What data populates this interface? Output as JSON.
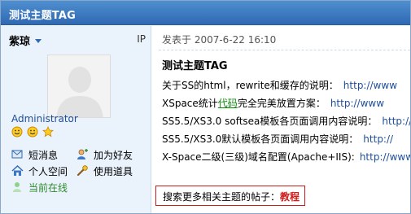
{
  "window": {
    "title": "测试主题TAG"
  },
  "sidebar": {
    "username": "紫琼",
    "ip_label": "IP",
    "role": "Administrator",
    "badges": [
      "smiley-icon",
      "smiley-icon",
      "star-icon"
    ],
    "actions": [
      {
        "label": "短消息",
        "icon": "message-icon"
      },
      {
        "label": "加为好友",
        "icon": "add-friend-icon"
      },
      {
        "label": "个人空间",
        "icon": "home-icon"
      },
      {
        "label": "使用道具",
        "icon": "tool-icon"
      },
      {
        "label": "当前在线",
        "icon": "online-user-icon"
      }
    ]
  },
  "post": {
    "meta": "发表于 2007-6-22 16:10",
    "title": "测试主题TAG",
    "lines": [
      {
        "text": "关于SS的html，rewrite和缓存的说明：",
        "url": "http://www"
      },
      {
        "pre": "XSpace统计",
        "highlight": "代码",
        "post": "完全完美放置方案：",
        "url": "http://www"
      },
      {
        "text": "SS5.5/XS3.0 softsea模板各页面调用内容说明：",
        "url": "http://w"
      },
      {
        "text": "SS5.5/XS3.0默认模板各页面调用内容说明：",
        "url": "http://"
      },
      {
        "text": "X-Space二级(三级)域名配置(Apache+IIS):",
        "url": "http://www"
      }
    ],
    "search_prefix": "搜索更多相关主题的帖子：",
    "search_keyword": "教程"
  },
  "colors": {
    "title_bar": "#3a7cc4",
    "sidebar_bg": "#eaf2fb",
    "link": "#1f4e9a",
    "online": "#2e8b2e",
    "search_border": "#d11a1a"
  }
}
